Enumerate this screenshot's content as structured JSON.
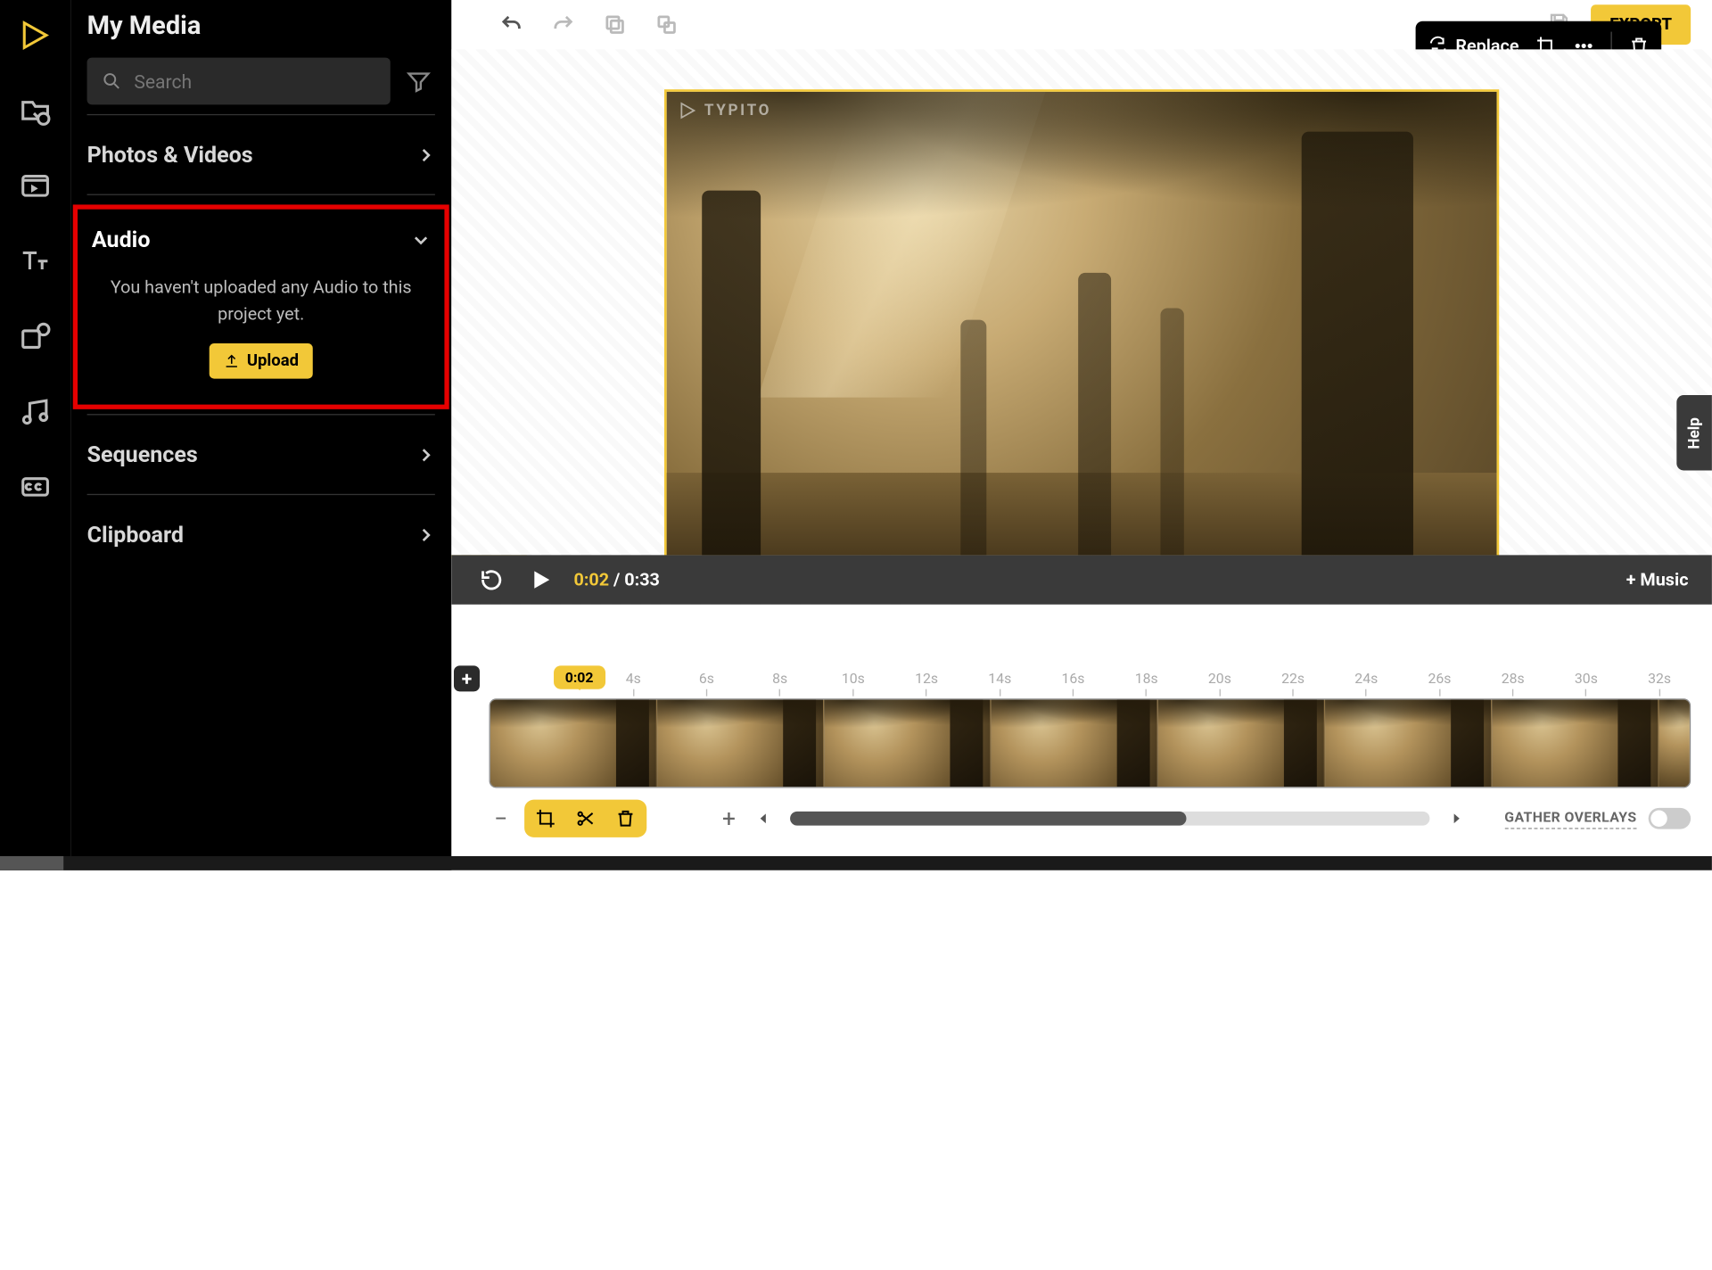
{
  "panel": {
    "title": "My Media",
    "search_placeholder": "Search",
    "sections": {
      "photos": "Photos & Videos",
      "audio": "Audio",
      "sequences": "Sequences",
      "clipboard": "Clipboard"
    },
    "audio_empty": "You haven't uploaded any Audio to this project yet.",
    "upload_label": "Upload"
  },
  "top": {
    "export": "EXPORT"
  },
  "cliptool": {
    "replace": "Replace"
  },
  "watermark": "TYPITO",
  "player": {
    "current": "0:02",
    "sep": " / ",
    "total": "0:33",
    "music": "+ Music"
  },
  "timeline": {
    "playhead": "0:02",
    "ticks": [
      "4s",
      "6s",
      "8s",
      "10s",
      "12s",
      "14s",
      "16s",
      "18s",
      "20s",
      "22s",
      "24s",
      "26s",
      "28s",
      "30s",
      "32s"
    ],
    "gather": "GATHER OVERLAYS"
  },
  "help": "Help"
}
